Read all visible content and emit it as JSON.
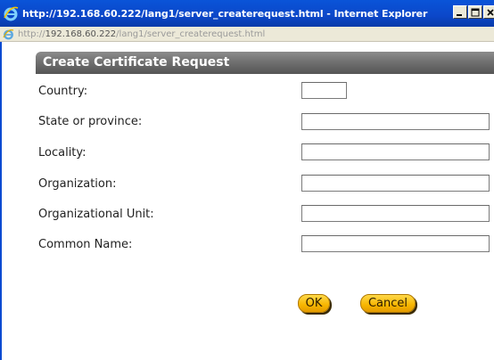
{
  "window": {
    "title": "http://192.168.60.222/lang1/server_createrequest.html - Internet Explorer",
    "icon": "internet-explorer-icon"
  },
  "address": {
    "prefix": "http://",
    "host": "192.168.60.222",
    "path": "/lang1/server_createrequest.html"
  },
  "form": {
    "heading": "Create Certificate Request",
    "fields": [
      {
        "label": "Country:",
        "value": ""
      },
      {
        "label": "State or province:",
        "value": ""
      },
      {
        "label": "Locality:",
        "value": ""
      },
      {
        "label": "Organization:",
        "value": ""
      },
      {
        "label": "Organizational Unit:",
        "value": ""
      },
      {
        "label": "Common Name:",
        "value": ""
      }
    ],
    "ok_label": "OK",
    "cancel_label": "Cancel"
  },
  "colors": {
    "titlebar": "#0b47c9",
    "header": "#6e6e6e",
    "button": "#f7b500"
  }
}
